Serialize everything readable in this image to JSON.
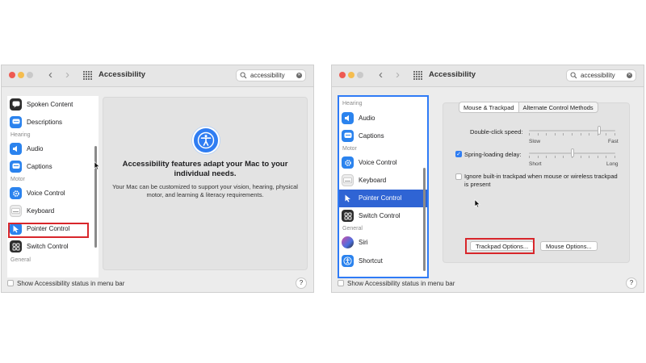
{
  "window1": {
    "title": "Accessibility",
    "search": {
      "value": "accessibility"
    },
    "sidebar": {
      "items": [
        {
          "label": "Spoken Content",
          "icon": "speech-bubble-icon"
        },
        {
          "label": "Descriptions",
          "icon": "speech-bubble-icon"
        },
        {
          "section": "Hearing"
        },
        {
          "label": "Audio",
          "icon": "speaker-icon"
        },
        {
          "label": "Captions",
          "icon": "captions-icon"
        },
        {
          "section": "Motor"
        },
        {
          "label": "Voice Control",
          "icon": "gear-icon"
        },
        {
          "label": "Keyboard",
          "icon": "keyboard-icon"
        },
        {
          "label": "Pointer Control",
          "icon": "pointer-icon"
        },
        {
          "label": "Switch Control",
          "icon": "switch-grid-icon"
        },
        {
          "section": "General"
        }
      ]
    },
    "pane": {
      "headline": "Accessibility features adapt your Mac to your individual needs.",
      "body": "Your Mac can be customized to support your vision, hearing, physical motor, and learning & literacy requirements."
    },
    "footer": {
      "checkbox_label": "Show Accessibility status in menu bar",
      "help": "?"
    }
  },
  "window2": {
    "title": "Accessibility",
    "search": {
      "value": "accessibility"
    },
    "sidebar": {
      "items": [
        {
          "section": "Hearing"
        },
        {
          "label": "Audio",
          "icon": "speaker-icon"
        },
        {
          "label": "Captions",
          "icon": "captions-icon"
        },
        {
          "section": "Motor"
        },
        {
          "label": "Voice Control",
          "icon": "gear-icon"
        },
        {
          "label": "Keyboard",
          "icon": "keyboard-icon"
        },
        {
          "label": "Pointer Control",
          "icon": "pointer-icon",
          "selected": true
        },
        {
          "label": "Switch Control",
          "icon": "switch-grid-icon"
        },
        {
          "section": "General"
        },
        {
          "label": "Siri",
          "icon": "siri-icon"
        },
        {
          "label": "Shortcut",
          "icon": "accessibility-icon"
        }
      ]
    },
    "tabs": [
      "Mouse & Trackpad",
      "Alternate Control Methods"
    ],
    "active_tab": "Mouse & Trackpad",
    "double_click": {
      "label": "Double-click speed:",
      "min_label": "Slow",
      "max_label": "Fast",
      "level": 0.83
    },
    "spring_loading": {
      "label": "Spring-loading delay:",
      "checked": true,
      "min_label": "Short",
      "max_label": "Long",
      "level": 0.5
    },
    "ignore_trackpad": {
      "label": "Ignore built-in trackpad when mouse or wireless trackpad is present",
      "checked": false
    },
    "buttons": {
      "trackpad_options": "Trackpad Options...",
      "mouse_options": "Mouse Options..."
    },
    "footer": {
      "checkbox_label": "Show Accessibility status in menu bar",
      "help": "?"
    }
  },
  "colors": {
    "accent": "#2f64d4",
    "highlight": "#d8262b",
    "focus_ring": "#2f7bf6"
  }
}
